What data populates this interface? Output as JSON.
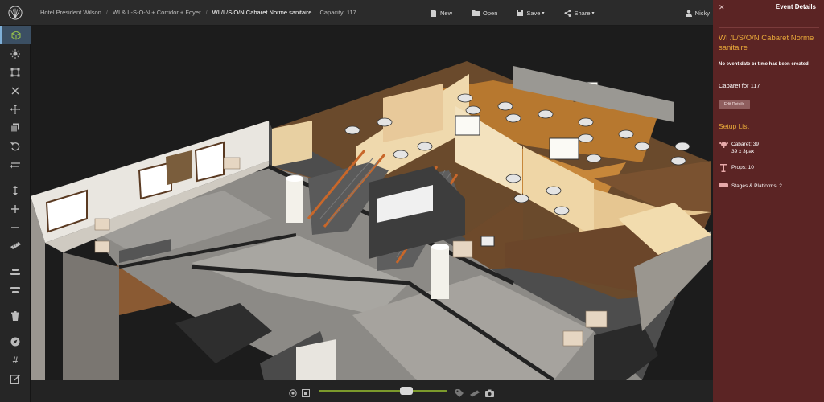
{
  "header": {
    "breadcrumbs": [
      "Hotel President Wilson",
      "WI & L-S-O-N + Corridor + Foyer",
      "WI /L/S/O/N Cabaret Norme sanitaire"
    ],
    "capacity": "Capacity: 117",
    "actions": [
      {
        "label": "New",
        "icon": "file-icon"
      },
      {
        "label": "Open",
        "icon": "folder-icon"
      },
      {
        "label": "Save",
        "icon": "save-icon",
        "dropdown": true
      },
      {
        "label": "Share",
        "icon": "share-icon",
        "dropdown": true
      }
    ],
    "user": "Nicky"
  },
  "toolbar": {
    "tools": [
      "cube-icon",
      "sun-icon",
      "select-box-icon",
      "close-icon",
      "move-icon",
      "duplicate-icon",
      "undo-icon",
      "swap-icon",
      "vertical-arrows-icon",
      "plus-icon",
      "minus-icon",
      "ruler-icon",
      "align-top-icon",
      "align-center-icon",
      "trash-icon",
      "compass-icon",
      "hash-icon",
      "edit-icon"
    ]
  },
  "bottom": {
    "zoom_level": 0.68
  },
  "panel": {
    "title": "Event Details",
    "event_name": "WI /L/S/O/N Cabaret Norme sanitaire",
    "warning": "No event date or time has been created",
    "subtitle": "Cabaret for 117",
    "edit_label": "Edit Details",
    "setup_heading": "Setup List",
    "setup_items": [
      {
        "label": "Cabaret: 39",
        "sub": "39 x 3pax",
        "icon": "round-table-icon"
      },
      {
        "label": "Props: 10",
        "sub": "",
        "icon": "prop-icon"
      },
      {
        "label": "Stages & Platforms: 2",
        "sub": "",
        "icon": "stage-icon"
      }
    ]
  },
  "colors": {
    "accent": "#e8a83a",
    "panel_bg": "#5b2424",
    "zoom_track": "#7c9a2c"
  }
}
